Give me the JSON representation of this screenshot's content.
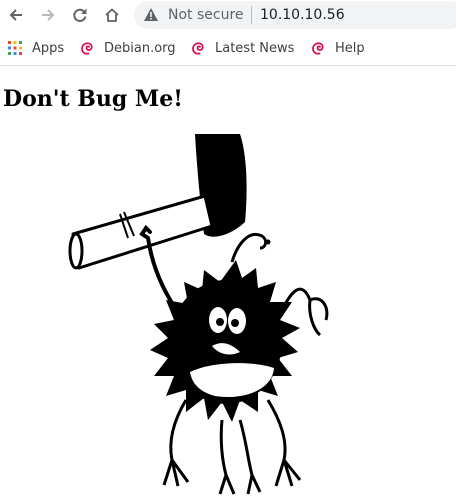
{
  "browser": {
    "security_label": "Not secure",
    "url": "10.10.10.56",
    "icons": {
      "back": "arrow-left-icon",
      "forward": "arrow-right-icon",
      "reload": "reload-icon",
      "home": "home-icon",
      "security": "warning-triangle-icon"
    }
  },
  "bookmarks": {
    "items": [
      {
        "label": "Apps",
        "icon": "apps-grid-icon"
      },
      {
        "label": "Debian.org",
        "icon": "debian-swirl-icon"
      },
      {
        "label": "Latest News",
        "icon": "debian-swirl-icon"
      },
      {
        "label": "Help",
        "icon": "debian-swirl-icon"
      }
    ]
  },
  "page": {
    "title": "Don't Bug Me!"
  },
  "colors": {
    "omnibox_bg": "#f1f3f4",
    "icon_gray": "#5f6368",
    "debian_red": "#d70a53"
  }
}
